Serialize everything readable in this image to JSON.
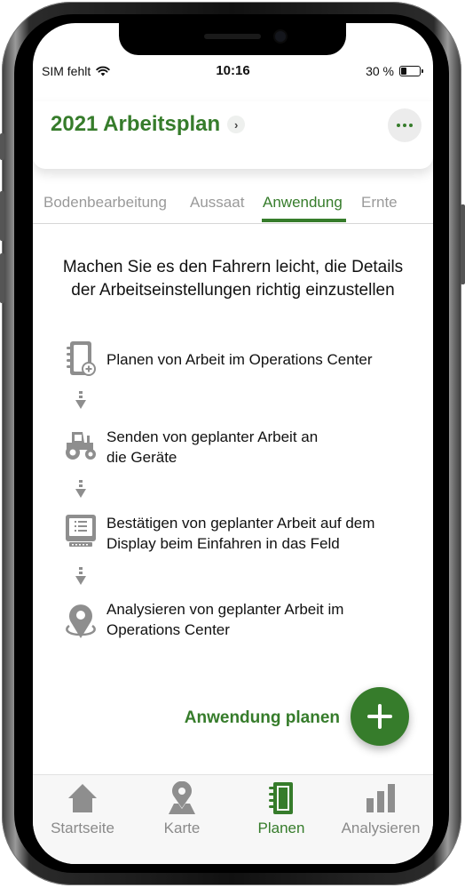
{
  "status_bar": {
    "carrier": "SIM fehlt",
    "time": "10:16",
    "battery_percent_label": "30 %",
    "battery_level": 0.3
  },
  "header": {
    "title": "2021 Arbeitsplan",
    "title_chevron": "›",
    "more_icon": "ellipsis-icon"
  },
  "tabs": [
    {
      "label": "Bodenbearbeitung",
      "active": false
    },
    {
      "label": "Aussaat",
      "active": false
    },
    {
      "label": "Anwendung",
      "active": true
    },
    {
      "label": "Ernte",
      "active": false
    }
  ],
  "main": {
    "headline_line1": "Machen Sie es den Fahrern leicht, die Details",
    "headline_line2": "der Arbeitseinstellungen richtig einzustellen",
    "steps": [
      {
        "icon": "notebook-plus-icon",
        "line1": "Planen von Arbeit im Operations Center",
        "line2": ""
      },
      {
        "icon": "tractor-icon",
        "line1": "Senden von geplanter Arbeit an",
        "line2": "die Geräte"
      },
      {
        "icon": "display-icon",
        "line1": "Bestätigen von geplanter Arbeit auf dem",
        "line2": "Display beim Einfahren in das Feld"
      },
      {
        "icon": "map-pin-icon",
        "line1": "Analysieren von geplanter Arbeit im",
        "line2": "Operations Center"
      }
    ],
    "cta_label": "Anwendung planen",
    "fab_icon": "plus-icon"
  },
  "tab_bar": {
    "items": [
      {
        "label": "Startseite",
        "icon": "home-icon",
        "active": false
      },
      {
        "label": "Karte",
        "icon": "map-pin-icon",
        "active": false
      },
      {
        "label": "Planen",
        "icon": "notebook-icon",
        "active": true
      },
      {
        "label": "Analysieren",
        "icon": "bar-chart-icon",
        "active": false
      }
    ]
  },
  "colors": {
    "accent": "#367c2b",
    "inactive": "#9a9a9a",
    "icon_gray": "#8e8e8e"
  }
}
